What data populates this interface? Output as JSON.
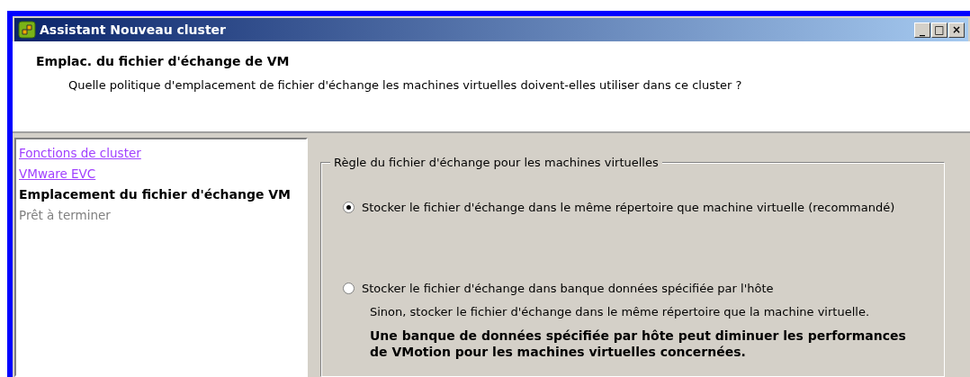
{
  "window": {
    "title": "Assistant Nouveau cluster",
    "controls": [
      "_",
      "□",
      "×"
    ]
  },
  "header": {
    "title": "Emplac. du fichier d'échange de VM",
    "subtitle": "Quelle politique d'emplacement de fichier d'échange les machines virtuelles doivent-elles utiliser dans ce cluster ?"
  },
  "steps": [
    {
      "label": "Fonctions de cluster",
      "kind": "visited"
    },
    {
      "label": "VMware EVC",
      "kind": "visited"
    },
    {
      "label": "Emplacement du fichier d'échange VM",
      "kind": "current"
    },
    {
      "label": "Prêt à terminer",
      "kind": "pending"
    }
  ],
  "group": {
    "legend": "Règle du fichier d'échange pour les machines virtuelles",
    "options": [
      {
        "label": "Stocker le fichier d'échange dans le même répertoire que machine virtuelle (recommandé)",
        "selected": true
      },
      {
        "label": "Stocker le fichier d'échange dans banque données spécifiée par l'hôte",
        "selected": false,
        "note": "Sinon, stocker le fichier d'échange dans le même répertoire que la machine virtuelle.",
        "warning": "Une banque de données spécifiée par hôte peut diminuer les performances de VMotion pour les machines virtuelles concernées."
      }
    ]
  }
}
